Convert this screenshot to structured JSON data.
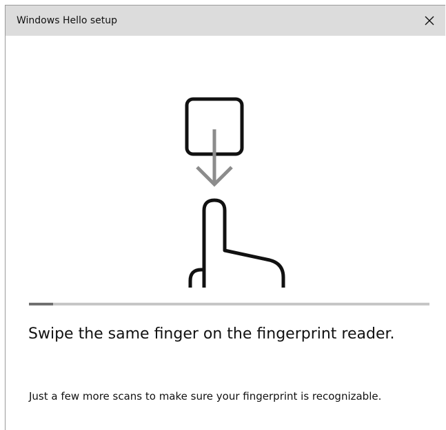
{
  "window": {
    "title": "Windows Hello setup"
  },
  "titlebar": {
    "close_icon": "close-icon"
  },
  "illustration": {
    "icons": [
      "sensor-square-icon",
      "down-arrow-icon",
      "pointing-finger-icon"
    ]
  },
  "progress": {
    "value": 0.06,
    "track_color": "#c6c6c6",
    "fill_color": "#707070"
  },
  "content": {
    "heading": "Swipe the same finger on the fingerprint reader.",
    "subtext": "Just a few more scans to make sure your fingerprint is recognizable."
  }
}
